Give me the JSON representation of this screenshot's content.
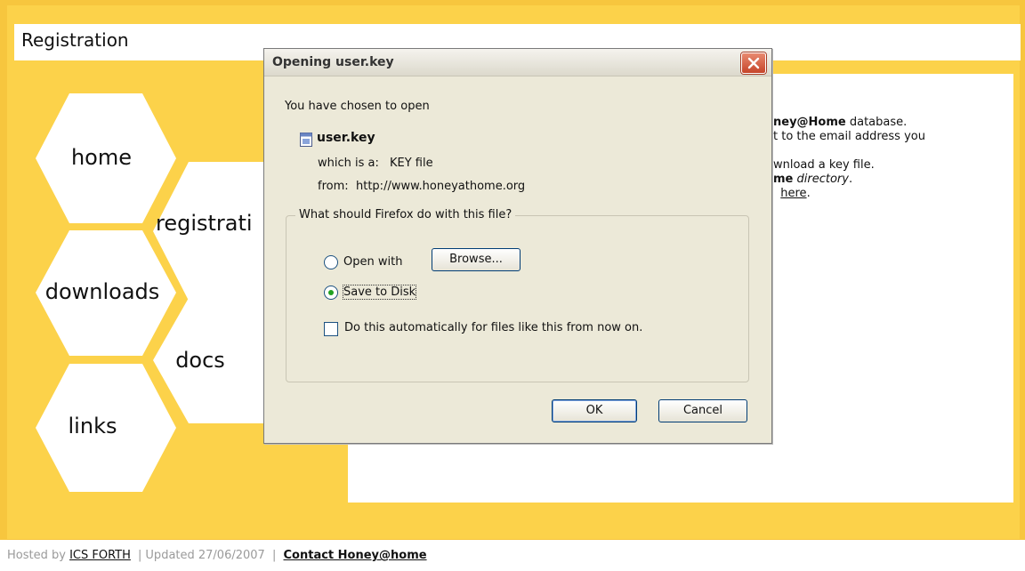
{
  "page": {
    "title": "Registration"
  },
  "nav": {
    "items": [
      {
        "label": "home"
      },
      {
        "label": "registrati"
      },
      {
        "label": "downloads"
      },
      {
        "label": "docs"
      },
      {
        "label": "links"
      }
    ]
  },
  "content": {
    "line1_bold": "ney@Home",
    "line1_rest": " database.",
    "line2": "t to the email address you",
    "line3": "wnload a key file.",
    "line4_bold": "me",
    "line4_italic": "directory",
    "line4_rest": ".",
    "line5_link": "here",
    "line5_rest": "."
  },
  "footer": {
    "hosted_by": "Hosted by",
    "ics_link": "ICS FORTH",
    "sep": "|",
    "updated": "Updated 27/06/2007",
    "contact_link": "Contact Honey@home"
  },
  "dialog": {
    "title": "Opening user.key",
    "intro": "You have chosen to open",
    "filename": "user.key",
    "which_is_label": "which is a:",
    "which_is_value": "KEY file",
    "from_label": "from:",
    "from_value": "http://www.honeyathome.org",
    "group_label": "What should Firefox do with this file?",
    "open_with_label": "Open with",
    "browse_label": "Browse...",
    "save_to_disk_label": "Save to Disk",
    "auto_label": "Do this automatically for files like this from now on.",
    "ok_label": "OK",
    "cancel_label": "Cancel",
    "selected_option": "Save to Disk",
    "auto_checked": false
  },
  "colors": {
    "page_yellow": "#fcd24a",
    "dialog_bg": "#ece9d8",
    "close_red": "#c6452a"
  }
}
